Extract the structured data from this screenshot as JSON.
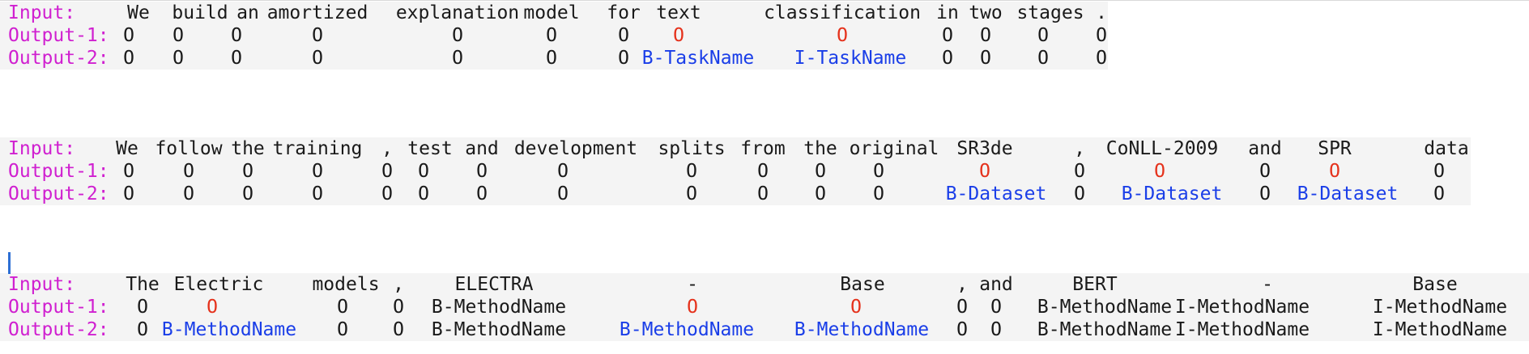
{
  "colors": {
    "label": "#d020d0",
    "token": "#1a1a1a",
    "tag_o_highlight": "#e5321c",
    "entity_tag": "#1a3ee8",
    "caret": "#2d6fd4"
  },
  "examples": [
    {
      "input_label": "Input:",
      "output1_label": "Output-1:",
      "output2_label": "Output-2:",
      "tokens": [
        {
          "word": "We",
          "out1": "O",
          "out2": "O"
        },
        {
          "word": "build",
          "out1": "O",
          "out2": "O"
        },
        {
          "word": "an",
          "out1": "O",
          "out2": "O"
        },
        {
          "word": "amortized",
          "out1": "O",
          "out2": "O"
        },
        {
          "word": "explanation",
          "out1": "O",
          "out2": "O"
        },
        {
          "word": "model",
          "out1": "O",
          "out2": "O"
        },
        {
          "word": "for",
          "out1": "O",
          "out2": "O"
        },
        {
          "word": "text",
          "out1": "O",
          "out1_red": true,
          "out2": "B-TaskName",
          "out2_blue": true
        },
        {
          "word": "classification",
          "out1": "O",
          "out1_red": true,
          "out2": "I-TaskName",
          "out2_blue": true
        },
        {
          "word": "in",
          "out1": "O",
          "out2": "O"
        },
        {
          "word": "two",
          "out1": "O",
          "out2": "O"
        },
        {
          "word": "stages",
          "out1": "O",
          "out2": "O"
        },
        {
          "word": ".",
          "out1": "O",
          "out2": "O"
        }
      ]
    },
    {
      "input_label": "Input:",
      "output1_label": "Output-1:",
      "output2_label": "Output-2:",
      "tokens": [
        {
          "word": "We",
          "out1": "O",
          "out2": "O"
        },
        {
          "word": "follow",
          "out1": "O",
          "out2": "O"
        },
        {
          "word": "the",
          "out1": "O",
          "out2": "O"
        },
        {
          "word": "training",
          "out1": "O",
          "out2": "O"
        },
        {
          "word": ",",
          "out1": "O",
          "out2": "O"
        },
        {
          "word": "test",
          "out1": "O",
          "out2": "O"
        },
        {
          "word": "and",
          "out1": "O",
          "out2": "O"
        },
        {
          "word": "development",
          "out1": "O",
          "out2": "O"
        },
        {
          "word": "splits",
          "out1": "O",
          "out2": "O"
        },
        {
          "word": "from",
          "out1": "O",
          "out2": "O"
        },
        {
          "word": "the",
          "out1": "O",
          "out2": "O"
        },
        {
          "word": "original",
          "out1": "O",
          "out2": "O"
        },
        {
          "word": "SR3de",
          "out1": "O",
          "out1_red": true,
          "out2": "B-Dataset",
          "out2_blue": true
        },
        {
          "word": ",",
          "out1": "O",
          "out2": "O"
        },
        {
          "word": "CoNLL-2009",
          "out1": "O",
          "out1_red": true,
          "out2": "B-Dataset",
          "out2_blue": true
        },
        {
          "word": "and",
          "out1": "O",
          "out2": "O"
        },
        {
          "word": "SPR",
          "out1": "O",
          "out1_red": true,
          "out2": "B-Dataset",
          "out2_blue": true
        },
        {
          "word": "data",
          "out1": "O",
          "out2": "O"
        }
      ]
    },
    {
      "input_label": "Input:",
      "output1_label": "Output-1:",
      "output2_label": "Output-2:",
      "tokens": [
        {
          "word": "The",
          "out1": "O",
          "out2": "O"
        },
        {
          "word": "Electric",
          "out1": "O",
          "out1_red": true,
          "out2": "B-MethodName",
          "out2_blue": true
        },
        {
          "word": "models",
          "out1": "O",
          "out2": "O"
        },
        {
          "word": ",",
          "out1": "O",
          "out2": "O"
        },
        {
          "word": "ELECTRA",
          "out1": "B-MethodName",
          "out2": "B-MethodName"
        },
        {
          "word": "-",
          "out1": "O",
          "out1_red": true,
          "out2": "B-MethodName",
          "out2_blue": true
        },
        {
          "word": "Base",
          "out1": "O",
          "out1_red": true,
          "out2": "B-MethodName",
          "out2_blue": true
        },
        {
          "word": ",",
          "out1": "O",
          "out2": "O"
        },
        {
          "word": "and",
          "out1": "O",
          "out2": "O"
        },
        {
          "word": "BERT",
          "out1": "B-MethodName",
          "out2": "B-MethodName"
        },
        {
          "word": "-",
          "out1": "I-MethodName",
          "out2": "I-MethodName"
        },
        {
          "word": "Base",
          "out1": "I-MethodName",
          "out2": "I-MethodName"
        }
      ]
    }
  ]
}
